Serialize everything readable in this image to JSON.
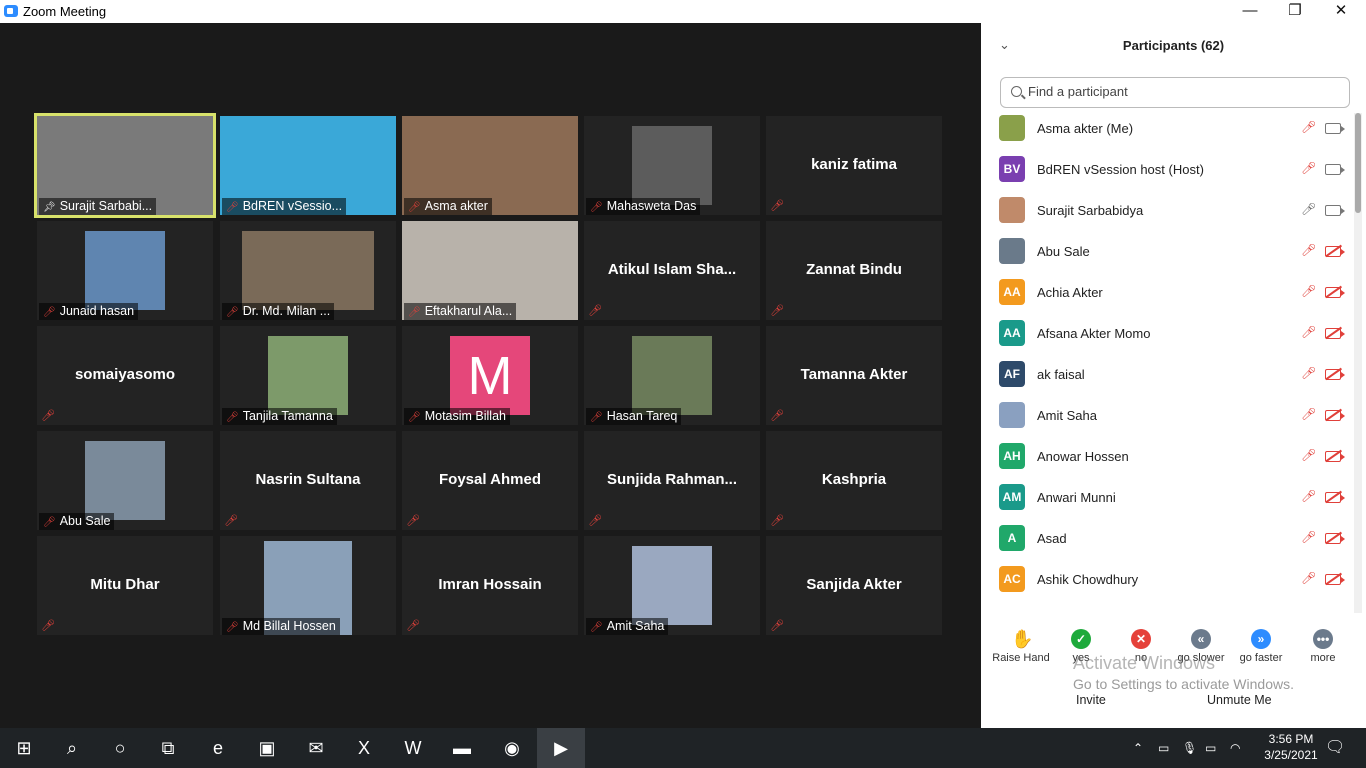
{
  "window": {
    "title": "Zoom Meeting",
    "minimize": "—",
    "maximize": "❐",
    "close": "✕"
  },
  "tiles": [
    {
      "name": "Surajit Sarbabi...",
      "center": "",
      "kind": "video",
      "pin": true,
      "active": true,
      "mic": false,
      "bg": "#7a7a7a"
    },
    {
      "name": "BdREN vSessio...",
      "center": "",
      "kind": "video",
      "mic": true,
      "bg": "#3aa8d8"
    },
    {
      "name": "Asma akter",
      "center": "",
      "kind": "video",
      "mic": true,
      "bg": "#8a6a52"
    },
    {
      "name": "Mahasweta Das",
      "center": "",
      "kind": "photo",
      "mic": true,
      "bg": "#5c5c5c"
    },
    {
      "name": "",
      "center": "kaniz fatima",
      "kind": "name",
      "mic": true
    },
    {
      "name": "Junaid hasan",
      "center": "",
      "kind": "photo",
      "mic": true,
      "bg": "#5f85b0"
    },
    {
      "name": "Dr. Md. Milan ...",
      "center": "",
      "kind": "photo",
      "mic": true,
      "bg": "#7a6a58",
      "wide": true
    },
    {
      "name": "Eftakharul Ala...",
      "center": "",
      "kind": "video",
      "mic": true,
      "bg": "#b8b2aa"
    },
    {
      "name": "",
      "center": "Atikul Islam Sha...",
      "kind": "name",
      "mic": true
    },
    {
      "name": "",
      "center": "Zannat Bindu",
      "kind": "name",
      "mic": true
    },
    {
      "name": "",
      "center": "somaiyasomo",
      "kind": "name",
      "mic": true
    },
    {
      "name": "Tanjila Tamanna",
      "center": "",
      "kind": "photo",
      "mic": true,
      "bg": "#7d9a6a"
    },
    {
      "name": "Motasim Billah",
      "center": "",
      "kind": "letter",
      "letter": "M",
      "mic": true
    },
    {
      "name": "Hasan Tareq",
      "center": "",
      "kind": "photo",
      "mic": true,
      "bg": "#6a7a58"
    },
    {
      "name": "",
      "center": "Tamanna Akter",
      "kind": "name",
      "mic": true
    },
    {
      "name": "Abu Sale",
      "center": "",
      "kind": "photo",
      "mic": true,
      "bg": "#7a8a9a"
    },
    {
      "name": "",
      "center": "Nasrin Sultana",
      "kind": "name",
      "mic": true
    },
    {
      "name": "",
      "center": "Foysal Ahmed",
      "kind": "name",
      "mic": true
    },
    {
      "name": "",
      "center": "Sunjida  Rahman...",
      "kind": "name",
      "mic": true
    },
    {
      "name": "",
      "center": "Kashpria",
      "kind": "name",
      "mic": true
    },
    {
      "name": "",
      "center": "Mitu Dhar",
      "kind": "name",
      "mic": true
    },
    {
      "name": "Md Billal Hossen",
      "center": "",
      "kind": "photo",
      "mic": true,
      "bg": "#8aa0b8",
      "tall": true
    },
    {
      "name": "",
      "center": "Imran Hossain",
      "kind": "name",
      "mic": true
    },
    {
      "name": "Amit Saha",
      "center": "",
      "kind": "photo",
      "mic": true,
      "bg": "#9aa8c0"
    },
    {
      "name": "",
      "center": "Sanjida Akter",
      "kind": "name",
      "mic": true
    }
  ],
  "panel": {
    "title": "Participants (62)",
    "collapse_icon": "⌄",
    "search_placeholder": "Find a participant",
    "participants": [
      {
        "initials": "",
        "name": "Asma akter (Me)",
        "color": "#8aa04a",
        "mic": "muted",
        "cam": "on"
      },
      {
        "initials": "BV",
        "name": "BdREN vSession host (Host)",
        "color": "#7a3fb0",
        "mic": "muted",
        "cam": "on"
      },
      {
        "initials": "",
        "name": "Surajit Sarbabidya",
        "color": "#c08a6a",
        "mic": "on",
        "cam": "on"
      },
      {
        "initials": "",
        "name": "Abu Sale",
        "color": "#6a7a8a",
        "mic": "muted",
        "cam": "off"
      },
      {
        "initials": "AA",
        "name": "Achia Akter",
        "color": "#f39a1e",
        "mic": "muted",
        "cam": "off"
      },
      {
        "initials": "AA",
        "name": "Afsana Akter Momo",
        "color": "#1a9a8a",
        "mic": "muted",
        "cam": "off"
      },
      {
        "initials": "AF",
        "name": "ak faisal",
        "color": "#2e4a6a",
        "mic": "muted",
        "cam": "off"
      },
      {
        "initials": "",
        "name": "Amit Saha",
        "color": "#8aa0c0",
        "mic": "muted",
        "cam": "off"
      },
      {
        "initials": "AH",
        "name": "Anowar Hossen",
        "color": "#20a86a",
        "mic": "muted",
        "cam": "off"
      },
      {
        "initials": "AM",
        "name": "Anwari Munni",
        "color": "#1a9a8a",
        "mic": "muted",
        "cam": "off"
      },
      {
        "initials": "A",
        "name": "Asad",
        "color": "#20a86a",
        "mic": "muted",
        "cam": "off"
      },
      {
        "initials": "AC",
        "name": "Ashik Chowdhury",
        "color": "#f39a1e",
        "mic": "muted",
        "cam": "off"
      }
    ],
    "reactions": [
      {
        "label": "Raise Hand",
        "glyph": "✋",
        "color": "#2d8cff",
        "shape": "plain"
      },
      {
        "label": "yes",
        "glyph": "✓",
        "color": "#1eaa3c",
        "shape": "circle"
      },
      {
        "label": "no",
        "glyph": "✕",
        "color": "#e5413a",
        "shape": "circle"
      },
      {
        "label": "go slower",
        "glyph": "«",
        "color": "#6b7a8c",
        "shape": "circle"
      },
      {
        "label": "go faster",
        "glyph": "»",
        "color": "#2d8cff",
        "shape": "circle"
      },
      {
        "label": "more",
        "glyph": "•••",
        "color": "#6b7a8c",
        "shape": "circle"
      }
    ],
    "watermark_line1": "Activate Windows",
    "watermark_line2": "Go to Settings to activate Windows.",
    "invite_label": "Invite",
    "unmute_label": "Unmute Me"
  },
  "taskbar": {
    "time": "3:56 PM",
    "date": "3/25/2021",
    "apps": [
      {
        "name": "start",
        "glyph": "⊞"
      },
      {
        "name": "search",
        "glyph": "⌕"
      },
      {
        "name": "cortana",
        "glyph": "○"
      },
      {
        "name": "task-view",
        "glyph": "⧉"
      },
      {
        "name": "edge",
        "glyph": "e"
      },
      {
        "name": "store",
        "glyph": "▣"
      },
      {
        "name": "mail",
        "glyph": "✉"
      },
      {
        "name": "excel",
        "glyph": "X"
      },
      {
        "name": "word",
        "glyph": "W"
      },
      {
        "name": "explorer",
        "glyph": "▬"
      },
      {
        "name": "chrome",
        "glyph": "◉"
      },
      {
        "name": "zoom",
        "glyph": "▶"
      }
    ]
  }
}
